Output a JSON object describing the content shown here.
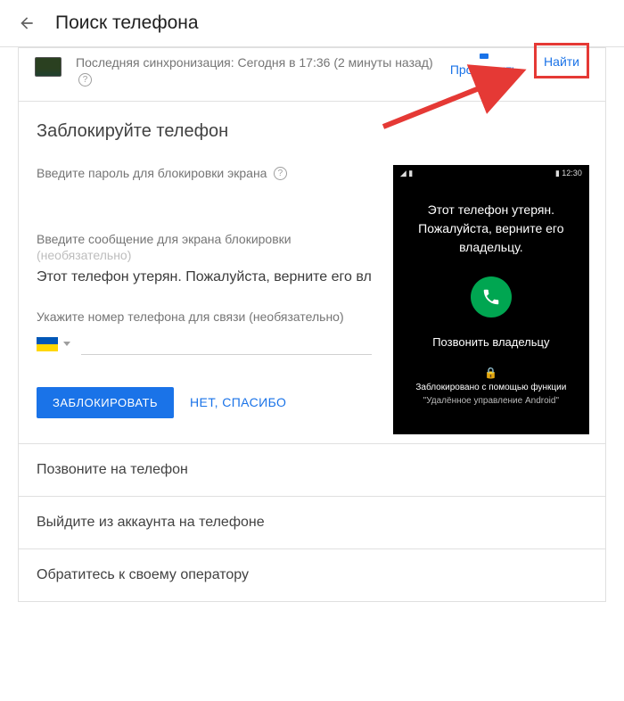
{
  "header": {
    "title": "Поиск телефона"
  },
  "device": {
    "sync_text": "Последняя синхронизация: Сегодня в 17:36 (2 минуты назад)",
    "actions": {
      "ring": "Прозвонить",
      "find": "Найти"
    }
  },
  "lock": {
    "title": "Заблокируйте телефон",
    "password_label": "Введите пароль для блокировки экрана",
    "message_label": "Введите сообщение для экрана блокировки",
    "message_optional": "(необязательно)",
    "message_value": "Этот телефон утерян. Пожалуйста, верните его вл",
    "phone_label": "Укажите номер телефона для связи (необязательно)",
    "buttons": {
      "lock": "ЗАБЛОКИРОВАТЬ",
      "no_thanks": "НЕТ, СПАСИБО"
    }
  },
  "preview": {
    "status_time": "12:30",
    "message": "Этот телефон утерян. Пожалуйста, верните его владельцу.",
    "call_owner": "Позвонить владельцу",
    "locked_line1": "Заблокировано с помощью функции",
    "locked_line2": "\"Удалённое управление Android\""
  },
  "options": {
    "call": "Позвоните на телефон",
    "signout": "Выйдите из аккаунта на телефоне",
    "carrier": "Обратитесь к своему оператору"
  }
}
